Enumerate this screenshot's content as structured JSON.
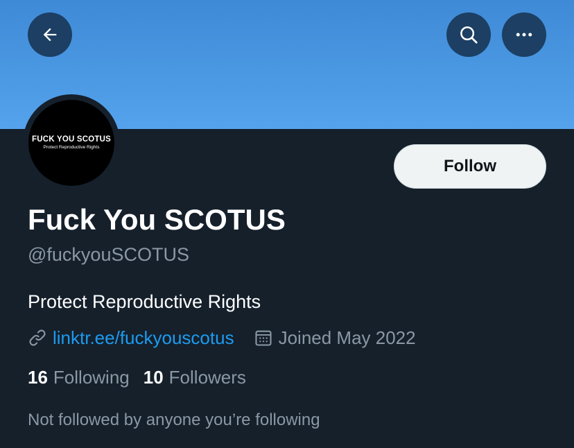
{
  "header": {
    "banner_color": "#4a97e2",
    "back_icon": "arrow-left-icon",
    "search_icon": "search-icon",
    "more_icon": "more-horizontal-icon"
  },
  "profile": {
    "avatar_line1": "FUCK YOU SCOTUS",
    "avatar_line2": "Protect Reproductive Rights",
    "display_name": "Fuck You SCOTUS",
    "handle": "@fuckyouSCOTUS",
    "bio": "Protect Reproductive Rights",
    "link_text": "linktr.ee/fuckyouscotus",
    "link_icon": "link-icon",
    "joined_text": "Joined May 2022",
    "calendar_icon": "calendar-icon"
  },
  "actions": {
    "follow_label": "Follow"
  },
  "stats": {
    "following_count": "16",
    "following_label": "Following",
    "followers_count": "10",
    "followers_label": "Followers"
  },
  "footer": {
    "not_followed_text": "Not followed by anyone you’re following"
  },
  "colors": {
    "background": "#15202b",
    "accent_link": "#1d9bf0",
    "secondary_text": "#8b98a5",
    "button_bg": "#1c3f63"
  }
}
